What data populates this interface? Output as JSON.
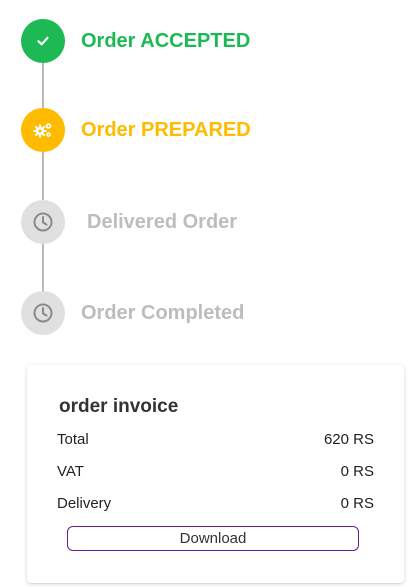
{
  "colors": {
    "accepted": "#1db954",
    "prepared": "#ffbb00",
    "pending_icon_bg": "#e0e0e0",
    "pending_icon_fg": "#8a8a8a",
    "pending_text": "#bdbdbd",
    "connector": "#b9b9b9",
    "button_border": "#6a1b9a"
  },
  "timeline": {
    "steps": [
      {
        "label": "Order ACCEPTED",
        "icon": "check-icon",
        "state": "done"
      },
      {
        "label": "Order PREPARED",
        "icon": "gears-icon",
        "state": "active"
      },
      {
        "label": "Delivered Order",
        "icon": "clock-icon",
        "state": "pending"
      },
      {
        "label": "Order Completed",
        "icon": "clock-icon",
        "state": "pending"
      }
    ]
  },
  "invoice": {
    "title": "order invoice",
    "rows": [
      {
        "label": "Total",
        "value": "620 RS"
      },
      {
        "label": "VAT",
        "value": "0 RS"
      },
      {
        "label": "Delivery",
        "value": "0 RS"
      }
    ],
    "download_label": "Download"
  }
}
